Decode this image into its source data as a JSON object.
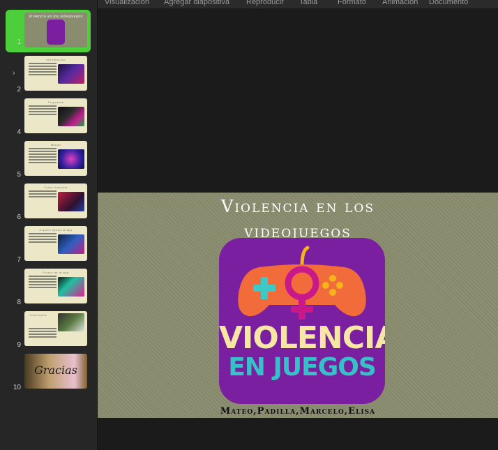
{
  "menu": [
    "Visualización",
    "Agregar diapositiva",
    "Reproducir",
    "Tabla",
    "Formato",
    "Animación",
    "Documento"
  ],
  "slides": [
    {
      "number": "1",
      "title": "Violencia en los videojuegos"
    },
    {
      "number": "2",
      "title": "Introducción"
    },
    {
      "number": "4",
      "title": "Propuesta"
    },
    {
      "number": "5",
      "title": "Misión"
    },
    {
      "number": "6",
      "title": "Como funciona"
    },
    {
      "number": "7",
      "title": "A quién ayuda la app"
    },
    {
      "number": "8",
      "title": "Futuro de la app"
    },
    {
      "number": "9",
      "title": "Conclusión"
    },
    {
      "number": "10",
      "title": "Gracias"
    }
  ],
  "selected_slide": 1,
  "main_slide": {
    "title_line1": "Violencia en los",
    "title_line2": "videojuegos",
    "logo_line1": "VIOLENCIA",
    "logo_line2": "EN JUEGOS",
    "authors": "Mateo,Padilla,Marcelo,Elisa"
  },
  "colors": {
    "selection": "#4ccf3b",
    "logo_bg": "#7a1fa0",
    "slide_bg": "#8a8c6f"
  },
  "icons": {
    "expand": "chevron-right-icon",
    "logo": "gamepad-venus-icon"
  }
}
